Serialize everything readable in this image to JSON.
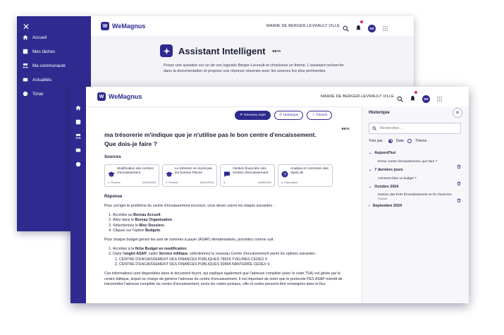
{
  "brand": {
    "name": "WeMagnus",
    "mark": "W"
  },
  "org": "MAIRIE DE BERGER-LEVRAULT VILLE",
  "user_initials": "SR",
  "sidebar": {
    "items": [
      {
        "label": "Accueil",
        "icon": "home-icon"
      },
      {
        "label": "Mes tâches",
        "icon": "tasks-icon"
      },
      {
        "label": "Ma communauté",
        "icon": "community-icon"
      },
      {
        "label": "Actualités",
        "icon": "news-icon"
      },
      {
        "label": "Tchat",
        "icon": "chat-icon"
      }
    ]
  },
  "back": {
    "title": "Assistant Intelligent",
    "beta": "BETA",
    "intro": "Posez une question sur un de vos logiciels Berger-Levrault et choisissez un thème. L'assistant recherche dans la documentation et propose une réponse résumée avec les sources les plus pertinentes."
  },
  "actions": {
    "new": "Nouveau sujet",
    "history": "Historique",
    "favorite": "Favoris"
  },
  "chat": {
    "beta": "BETA",
    "question": "ma trésorerie m'indique que je n'utilise pas le bon centre d'encaissement. Que dois-je faire ?",
    "sources_heading": "Sources",
    "sources": [
      {
        "title": "Modification des centres d'encaissement",
        "ref": "1. Finance",
        "date": "29/03/2024"
      },
      {
        "title": "Le trésorier ne reçoit pas les bonnes Pièces",
        "ref": "2. Finance",
        "date": "06/02/2015"
      },
      {
        "title": "Gestion financière des centres d'encaissement",
        "ref": "3.",
        "date": "10/08/2024"
      },
      {
        "title": "Analyse et correction des rejets de",
        "ref": "4. Facturation",
        "date": ""
      }
    ],
    "answer_heading": "Réponse",
    "answer": {
      "p1": "Pour corriger le problème du centre d'encaissement incorrect, vous devez suivre les étapes suivantes :",
      "steps1": [
        {
          "pre": "Accédez au ",
          "bold": "Bureau Accueil",
          "post": "."
        },
        {
          "pre": "Allez dans le ",
          "bold": "Bureau Organisation",
          "post": "."
        },
        {
          "pre": "Sélectionnez le ",
          "bold": "Bloc Dossiers",
          "post": "."
        },
        {
          "pre": "Cliquez sur l'option ",
          "bold": "Budgets",
          "post": "."
        }
      ],
      "p2": "Pour chaque budget gérant les avis de sommes à payer (ASAP) dématérialisés, procédez comme suit :",
      "s2_1_pre": "Accédez à la ",
      "s2_1_bold": "fiche Budget en modification",
      "s2_1_post": ".",
      "s2_2_pre": "Dans l'",
      "s2_2_bold1": "onglet ASAP",
      "s2_2_mid": ", cadre ",
      "s2_2_bold2": "Service éditique",
      "s2_2_post": ", sélectionnez le nouveau Centre d'encaissement parmi les options suivantes :",
      "sub": [
        "CENTRE D'ENCAISSEMENT DES FINANCES PUBLIQUES 78924 YVELINES CEDEX 9",
        "CENTRE D'ENCAISSEMENT DES FINANCES PUBLIQUES 92894 NANTERRE CEDEX 9"
      ],
      "p3": "Ces informations sont disponibles dans le document fourni, qui explique également que l'adresse complète (avec le code TSA) est gérée par le centre éditique, lequel se charge de générer l'adresse du centre d'encaissement. Il est important de noter que le protocole PES ASAP interdit de transmettre l'adresse complète du centre d'encaissement, seuls les codes postaux, ville et cedex peuvent être renseignés dans le flux."
    }
  },
  "history": {
    "title": "Historique",
    "search_placeholder": "Rechercher...",
    "sort_label": "Trier par :",
    "sort_date": "Date",
    "sort_theme": "Thème",
    "groups": [
      {
        "label": "Aujourd'hui",
        "item": "Erreur centre d'encaissement, que faire ?"
      },
      {
        "label": "7 derniers jours",
        "item": "comment faire un budget ?"
      },
      {
        "label": "Octobre 2024",
        "item": "Gestion des RAR d'investissement en fin d'exercice",
        "tag": "Finance"
      },
      {
        "label": "Septembre 2024"
      }
    ]
  },
  "colors": {
    "brand": "#2f2a8f",
    "notification": "#e0245e"
  }
}
